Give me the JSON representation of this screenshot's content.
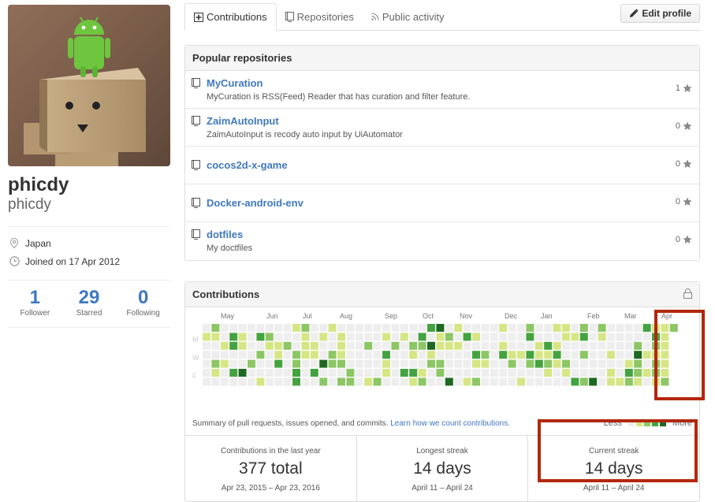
{
  "profile": {
    "fullname": "phicdy",
    "username": "phicdy",
    "location": "Japan",
    "joined": "Joined on 17 Apr 2012",
    "stats": [
      {
        "num": "1",
        "label": "Follower"
      },
      {
        "num": "29",
        "label": "Starred"
      },
      {
        "num": "0",
        "label": "Following"
      }
    ]
  },
  "tabs": [
    {
      "label": "Contributions",
      "icon": "plus-square-icon"
    },
    {
      "label": "Repositories",
      "icon": "repo-icon"
    },
    {
      "label": "Public activity",
      "icon": "rss-icon"
    }
  ],
  "edit_profile": {
    "label": "Edit profile",
    "icon": "pencil-icon"
  },
  "popular": {
    "title": "Popular repositories",
    "repos": [
      {
        "name": "MyCuration",
        "desc": "MyCuration is RSS(Feed) Reader that has curation and filter feature.",
        "stars": "1"
      },
      {
        "name": "ZaimAutoInput",
        "desc": "ZaimAutoInput is recody auto input by UiAutomator",
        "stars": "0"
      },
      {
        "name": "cocos2d-x-game",
        "desc": "",
        "stars": "0"
      },
      {
        "name": "Docker-android-env",
        "desc": "",
        "stars": "0"
      },
      {
        "name": "dotfiles",
        "desc": "My doctfiles",
        "stars": "0"
      }
    ]
  },
  "contributions": {
    "title": "Contributions",
    "months": [
      "May",
      "Jun",
      "Jul",
      "Aug",
      "Sep",
      "Oct",
      "Nov",
      "Dec",
      "Jan",
      "Feb",
      "Mar",
      "Apr"
    ],
    "days": [
      "M",
      "W",
      "F"
    ],
    "summary_text": "Summary of pull requests, issues opened, and commits.",
    "learn_link": "Learn how we count contributions.",
    "legend_less": "Less",
    "legend_more": "More",
    "colors": [
      "#eeeeee",
      "#d6e685",
      "#8cc665",
      "#44a340",
      "#1e6823"
    ],
    "stats": [
      {
        "label": "Contributions in the last year",
        "value": "377 total",
        "dates": "Apr 23, 2015 – Apr 23, 2016"
      },
      {
        "label": "Longest streak",
        "value": "14 days",
        "dates": "April 11 – April 24"
      },
      {
        "label": "Current streak",
        "value": "14 days",
        "dates": "April 11 – April 24"
      }
    ],
    "highlight_color": "#b2280c"
  }
}
